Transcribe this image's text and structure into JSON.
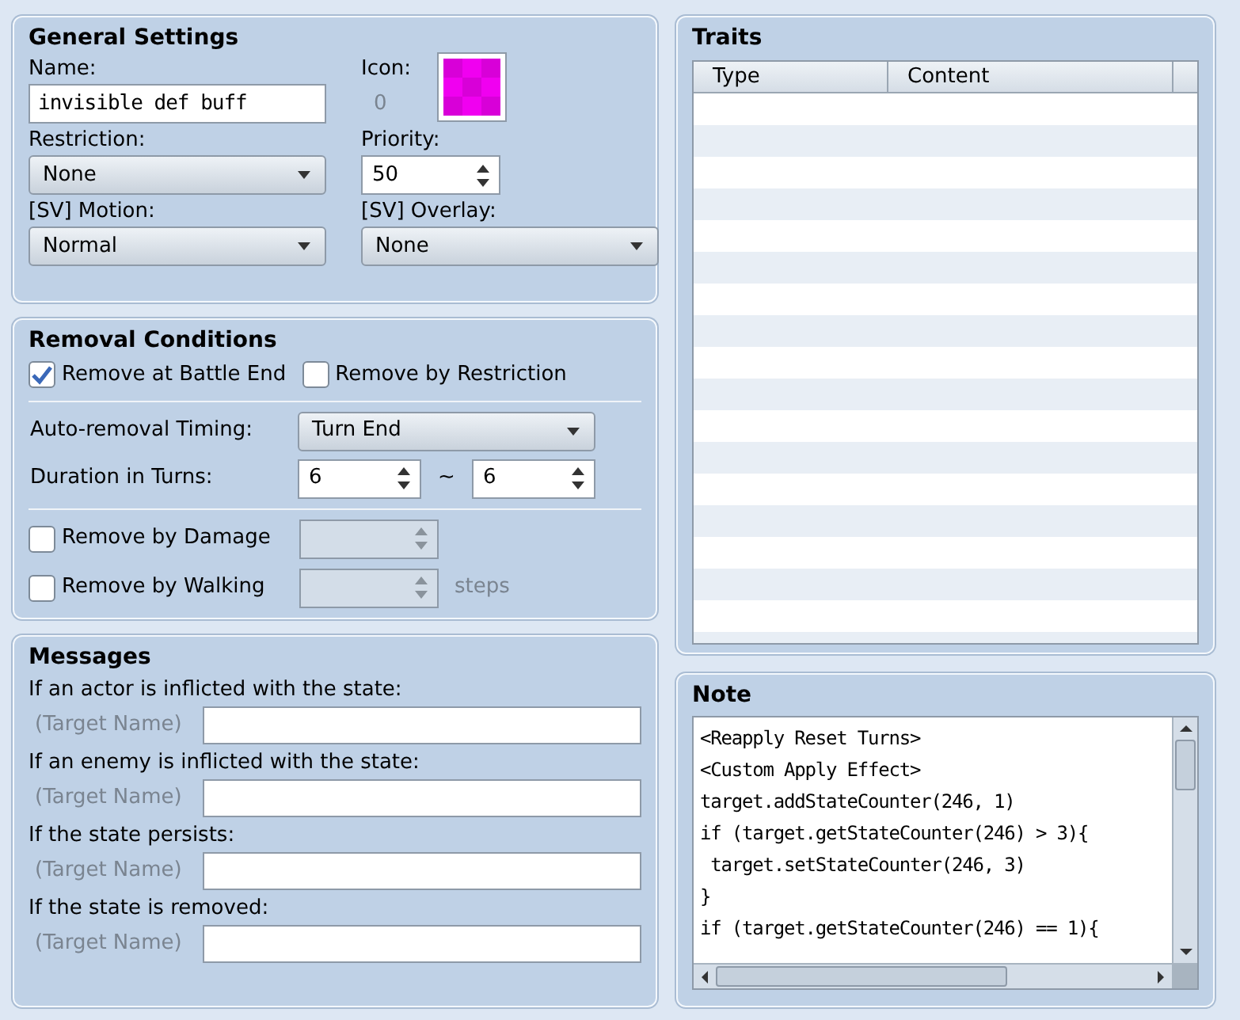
{
  "general": {
    "title": "General Settings",
    "name_label": "Name:",
    "name_value": "invisible def buff",
    "icon_label": "Icon:",
    "icon_index": "0",
    "restriction_label": "Restriction:",
    "restriction_value": "None",
    "priority_label": "Priority:",
    "priority_value": "50",
    "motion_label": "[SV] Motion:",
    "motion_value": "Normal",
    "overlay_label": "[SV] Overlay:",
    "overlay_value": "None"
  },
  "removal": {
    "title": "Removal Conditions",
    "checks": [
      {
        "label": "Remove at Battle End",
        "checked": true
      },
      {
        "label": "Remove by Restriction",
        "checked": false
      }
    ],
    "timing_label": "Auto-removal Timing:",
    "timing_value": "Turn End",
    "duration_label": "Duration in Turns:",
    "duration_min": "6",
    "tilde": "~",
    "duration_max": "6",
    "conditions": [
      {
        "label": "Remove by Damage",
        "checked": false,
        "disabled": true
      },
      {
        "label": "Remove by Walking",
        "checked": false,
        "disabled": true,
        "unit": "steps"
      }
    ]
  },
  "messages": {
    "title": "Messages",
    "items": [
      {
        "label": "If an actor is inflicted with the state:",
        "prefix": "(Target Name)"
      },
      {
        "label": "If an enemy is inflicted with the state:",
        "prefix": "(Target Name)"
      },
      {
        "label": "If the state persists:",
        "prefix": "(Target Name)"
      },
      {
        "label": "If the state is removed:",
        "prefix": "(Target Name)"
      }
    ]
  },
  "traits": {
    "title": "Traits",
    "columns": [
      "Type",
      "Content"
    ]
  },
  "note": {
    "title": "Note",
    "lines": [
      "<Reapply Reset Turns>",
      "<Custom Apply Effect>",
      "target.addStateCounter(246, 1)",
      "if (target.getStateCounter(246) > 3){",
      " target.setStateCounter(246, 3)",
      "}",
      "if (target.getStateCounter(246) == 1){"
    ]
  }
}
